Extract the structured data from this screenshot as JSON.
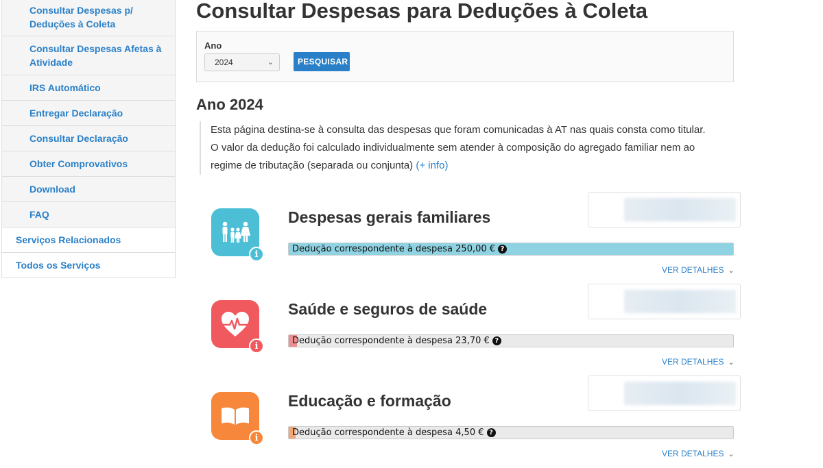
{
  "sidebar": {
    "items": [
      {
        "label": "Consultar Despesas p/ Deduções à Coleta"
      },
      {
        "label": "Consultar Despesas Afetas à Atividade"
      },
      {
        "label": "IRS Automático"
      },
      {
        "label": "Entregar Declaração"
      },
      {
        "label": "Consultar Declaração"
      },
      {
        "label": "Obter Comprovativos"
      },
      {
        "label": "Download"
      },
      {
        "label": "FAQ"
      },
      {
        "label": "Serviços Relacionados"
      },
      {
        "label": "Todos os Serviços"
      }
    ]
  },
  "page": {
    "title": "Consultar Despesas para Deduções à Coleta",
    "filter": {
      "year_label": "Ano",
      "year_value": "2024",
      "search_button": "PESQUISAR"
    },
    "year_heading": "Ano 2024",
    "info": {
      "line1": "Esta página destina-se à consulta das despesas que foram comunicadas à AT nas quais consta como titular.",
      "line2": "O valor da dedução foi calculado individualmente sem atender à composição do agregado familiar nem ao regime de tributação (separada ou conjunta)",
      "link": "(+ info)"
    }
  },
  "categories": [
    {
      "title": "Despesas gerais familiares",
      "icon": "family-icon",
      "color": "#4cbfd7",
      "fill_color": "#8fd3e3",
      "progress": 1.0,
      "deduction_text": "Dedução correspondente à despesa 250,00 €",
      "details_label": "VER DETALHES"
    },
    {
      "title": "Saúde e seguros de saúde",
      "icon": "heart-pulse-icon",
      "color": "#f05a5e",
      "fill_color": "#ec8f90",
      "progress": 0.018,
      "deduction_text": "Dedução correspondente à despesa 23,70 €",
      "details_label": "VER DETALHES"
    },
    {
      "title": "Educação e formação",
      "icon": "open-book-icon",
      "color": "#f7873a",
      "fill_color": "#f2a77a",
      "progress": 0.008,
      "deduction_text": "Dedução correspondente à despesa 4,50 €",
      "details_label": "VER DETALHES"
    }
  ]
}
